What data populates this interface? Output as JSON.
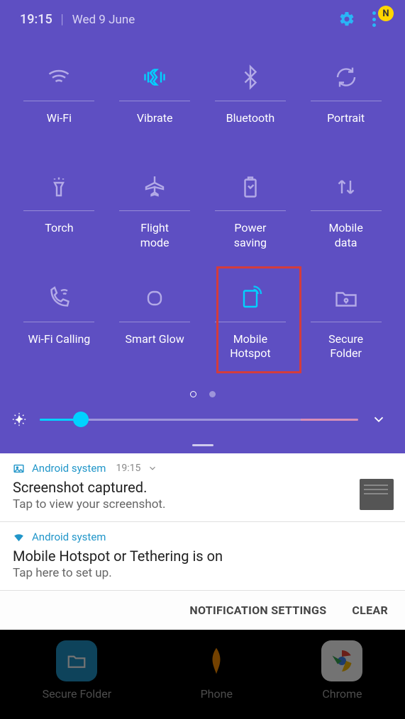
{
  "status": {
    "time": "19:15",
    "date": "Wed 9 June",
    "badge_letter": "N"
  },
  "tiles": [
    {
      "label": "Wi-Fi",
      "active": false
    },
    {
      "label": "Vibrate",
      "active": true
    },
    {
      "label": "Bluetooth",
      "active": false
    },
    {
      "label": "Portrait",
      "active": false
    },
    {
      "label": "Torch",
      "active": false
    },
    {
      "label": "Flight\nmode",
      "active": false
    },
    {
      "label": "Power\nsaving",
      "active": false
    },
    {
      "label": "Mobile\ndata",
      "active": false
    },
    {
      "label": "Wi-Fi Calling",
      "active": false
    },
    {
      "label": "Smart Glow",
      "active": false
    },
    {
      "label": "Mobile\nHotspot",
      "active": true
    },
    {
      "label": "Secure\nFolder",
      "active": false
    }
  ],
  "brightness": {
    "percent": 13
  },
  "notifications": [
    {
      "app": "Android system",
      "time": "19:15",
      "title": "Screenshot captured.",
      "subtitle": "Tap to view your screenshot.",
      "has_thumb": true,
      "expandable": true
    },
    {
      "app": "Android system",
      "time": "",
      "title": "Mobile Hotspot or Tethering is on",
      "subtitle": "Tap here to set up.",
      "has_thumb": false,
      "expandable": false
    }
  ],
  "actions": {
    "settings": "NOTIFICATION SETTINGS",
    "clear": "CLEAR"
  },
  "dock": [
    {
      "label": "Secure Folder"
    },
    {
      "label": "Phone"
    },
    {
      "label": "Chrome"
    }
  ]
}
